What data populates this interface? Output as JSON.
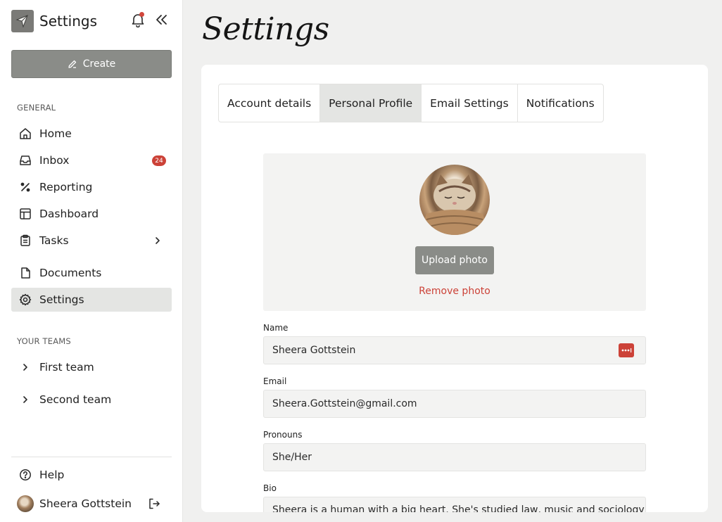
{
  "sidebar": {
    "title": "Settings",
    "create_label": "Create",
    "general_label": "GENERAL",
    "nav": [
      {
        "label": "Home",
        "icon": "home-icon"
      },
      {
        "label": "Inbox",
        "icon": "inbox-icon",
        "badge": "24"
      },
      {
        "label": "Reporting",
        "icon": "percent-icon"
      },
      {
        "label": "Dashboard",
        "icon": "dashboard-icon"
      },
      {
        "label": "Tasks",
        "icon": "clipboard-icon"
      },
      {
        "label": "Documents",
        "icon": "document-icon"
      },
      {
        "label": "Settings",
        "icon": "gear-icon",
        "active": true
      }
    ],
    "teams_label": "YOUR TEAMS",
    "teams": [
      {
        "label": "First team"
      },
      {
        "label": "Second team"
      }
    ],
    "help_label": "Help",
    "user_name": "Sheera Gottstein"
  },
  "main": {
    "title": "Settings",
    "tabs": [
      {
        "label": "Account details"
      },
      {
        "label": "Personal Profile",
        "active": true
      },
      {
        "label": "Email Settings"
      },
      {
        "label": "Notifications"
      }
    ],
    "upload_label": "Upload photo",
    "remove_label": "Remove photo",
    "fields": {
      "name_label": "Name",
      "name_value": "Sheera Gottstein",
      "email_label": "Email",
      "email_value": "Sheera.Gottstein@gmail.com",
      "pronouns_label": "Pronouns",
      "pronouns_value": "She/Her",
      "bio_label": "Bio",
      "bio_value": "Sheera is a human with a big heart. She's studied law, music and sociology, and"
    }
  },
  "colors": {
    "accent_red": "#cc4238",
    "button_gray": "#8a8c88",
    "active_bg": "#e4e5e3"
  }
}
